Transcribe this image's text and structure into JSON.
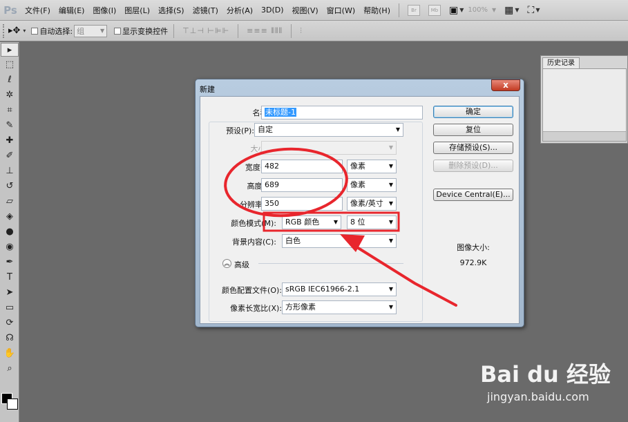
{
  "menubar": {
    "logo": "Ps",
    "items": [
      "文件(F)",
      "编辑(E)",
      "图像(I)",
      "图层(L)",
      "选择(S)",
      "滤镜(T)",
      "分析(A)",
      "3D(D)",
      "视图(V)",
      "窗口(W)",
      "帮助(H)"
    ],
    "icon_br": "Br",
    "icon_mb": "Mb",
    "zoom": "100%"
  },
  "options": {
    "auto_select_label": "自动选择:",
    "auto_select_value": "组",
    "show_transform_label": "显示变换控件"
  },
  "history": {
    "tab": "历史记录"
  },
  "dialog": {
    "title": "新建",
    "close": "x",
    "name_label": "名称(N):",
    "name_value": "未标题-1",
    "preset_label": "预设(P):",
    "preset_value": "自定",
    "size_label": "大小(I):",
    "width_label": "宽度(W):",
    "width_value": "482",
    "width_unit": "像素",
    "height_label": "高度(H):",
    "height_value": "689",
    "height_unit": "像素",
    "resolution_label": "分辨率(R):",
    "resolution_value": "350",
    "resolution_unit": "像素/英寸",
    "color_mode_label": "颜色模式(M):",
    "color_mode_value": "RGB 颜色",
    "bit_depth": "8 位",
    "bg_label": "背景内容(C):",
    "bg_value": "白色",
    "advanced": "高级",
    "profile_label": "颜色配置文件(O):",
    "profile_value": "sRGB IEC61966-2.1",
    "aspect_label": "像素长宽比(X):",
    "aspect_value": "方形像素",
    "ok": "确定",
    "reset": "复位",
    "save_preset": "存储预设(S)...",
    "delete_preset": "删除预设(D)...",
    "device_central": "Device Central(E)...",
    "image_size_label": "图像大小:",
    "image_size_value": "972.9K"
  },
  "watermark": {
    "logo": "Bai du 经验",
    "url": "jingyan.baidu.com"
  },
  "colors": {
    "annotation": "#e8262d",
    "dialog_frame": "#a9bdd2",
    "workspace": "#6a6a6a"
  }
}
